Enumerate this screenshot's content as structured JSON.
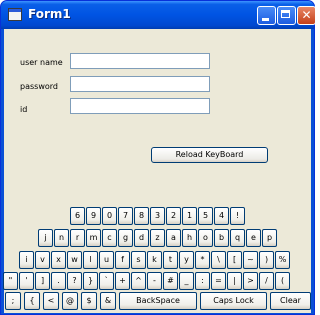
{
  "window": {
    "title": "Form1",
    "minimize_icon": "minimize-icon",
    "maximize_icon": "maximize-icon",
    "close_icon": "close-icon",
    "close_glyph": "✕"
  },
  "form": {
    "username_label": "user name",
    "password_label": "password",
    "id_label": "id",
    "username_value": "",
    "password_value": "",
    "id_value": "",
    "reload_button": "Reload KeyBoard"
  },
  "keyboard": {
    "rows": [
      [
        "6",
        "9",
        "0",
        "7",
        "8",
        "3",
        "2",
        "1",
        "5",
        "4",
        "!"
      ],
      [
        "j",
        "n",
        "r",
        "m",
        "c",
        "g",
        "d",
        "z",
        "a",
        "h",
        "o",
        "b",
        "q",
        "e",
        "p"
      ],
      [
        "i",
        "v",
        "x",
        "w",
        "l",
        "u",
        "f",
        "s",
        "k",
        "t",
        "y",
        "*",
        "\\",
        "[",
        "~",
        ")",
        "%"
      ],
      [
        "\"",
        "'",
        "]",
        ".",
        "?",
        "}",
        "`",
        "+",
        "^",
        "-",
        "#",
        "_",
        ":",
        "=",
        "|",
        ">",
        "/",
        "("
      ],
      [
        ";",
        "{",
        "<",
        "@",
        "$",
        "&",
        "BackSpace",
        "Caps Lock",
        "Clear"
      ]
    ]
  },
  "colors": {
    "titlebar": "#0054e3",
    "client_background": "#ece9d8",
    "button_border": "#003c74"
  }
}
